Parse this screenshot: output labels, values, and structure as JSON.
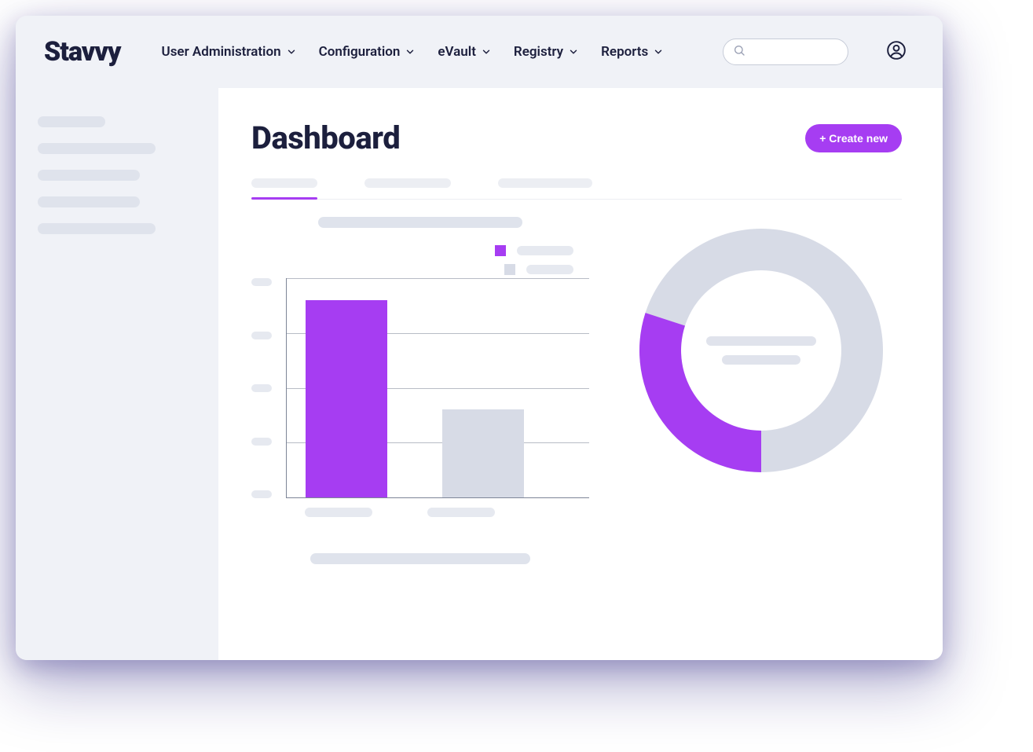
{
  "brand": "Stavvy",
  "nav": {
    "items": [
      {
        "label": "User Administration"
      },
      {
        "label": "Configuration"
      },
      {
        "label": "eVault"
      },
      {
        "label": "Registry"
      },
      {
        "label": "Reports"
      }
    ]
  },
  "search": {
    "placeholder": ""
  },
  "page": {
    "title": "Dashboard",
    "create_label": "+ Create new"
  },
  "colors": {
    "accent": "#a63df2",
    "muted": "#d7dbe6"
  },
  "chart_data": [
    {
      "type": "bar",
      "title": "",
      "categories": [
        "",
        ""
      ],
      "series": [
        {
          "name": "",
          "color": "#a63df2",
          "values": [
            90,
            null
          ]
        },
        {
          "name": "",
          "color": "#d7dbe6",
          "values": [
            null,
            40
          ]
        }
      ],
      "ylim": [
        0,
        100
      ],
      "y_ticks": 5,
      "xlabel": "",
      "ylabel": ""
    },
    {
      "type": "pie",
      "variant": "donut",
      "series": [
        {
          "name": "",
          "color": "#a63df2",
          "value": 30
        },
        {
          "name": "",
          "color": "#d7dbe6",
          "value": 70
        }
      ],
      "center_labels": [
        "",
        ""
      ]
    }
  ]
}
